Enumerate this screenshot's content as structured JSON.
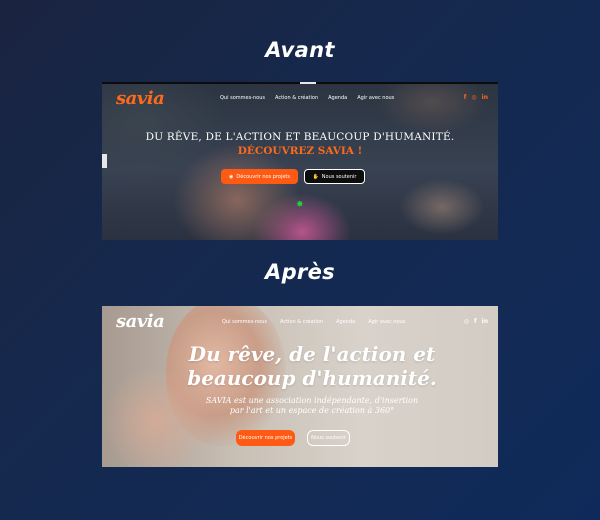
{
  "titles": {
    "before": "Avant",
    "after": "Après"
  },
  "avant": {
    "logo": "savia",
    "nav": [
      "Qui sommes-nous",
      "Action & création",
      "Agenda",
      "Agir avec nous"
    ],
    "social": [
      "f",
      "◎",
      "in"
    ],
    "headline": "DU RÊVE, DE L'ACTION ET BEAUCOUP D'HUMANITÉ.",
    "subheadline": "DÉCOUVREZ SAVIA !",
    "button_primary": "Découvrir nos projets",
    "button_secondary": "Nous soutenir",
    "colors": {
      "accent": "#ff5a14",
      "star": "#20d040"
    }
  },
  "apres": {
    "logo": "savia",
    "nav": [
      "Qui sommes-nous",
      "Action & création",
      "Agenda",
      "Agir avec nous"
    ],
    "social": [
      "◎",
      "f",
      "in"
    ],
    "headline_line1": "Du rêve, de l'action et",
    "headline_line2": "beaucoup d'humanité.",
    "description_line1": "SAVIA est une association indépendante, d'insertion",
    "description_line2": "par l'art et un espace de création à 360°",
    "button_primary": "Découvrir nos projets",
    "button_secondary": "Nous soutenir",
    "colors": {
      "accent": "#ff5a14"
    }
  },
  "background": {
    "from": "#1a2440",
    "to": "#0f2a5a"
  }
}
